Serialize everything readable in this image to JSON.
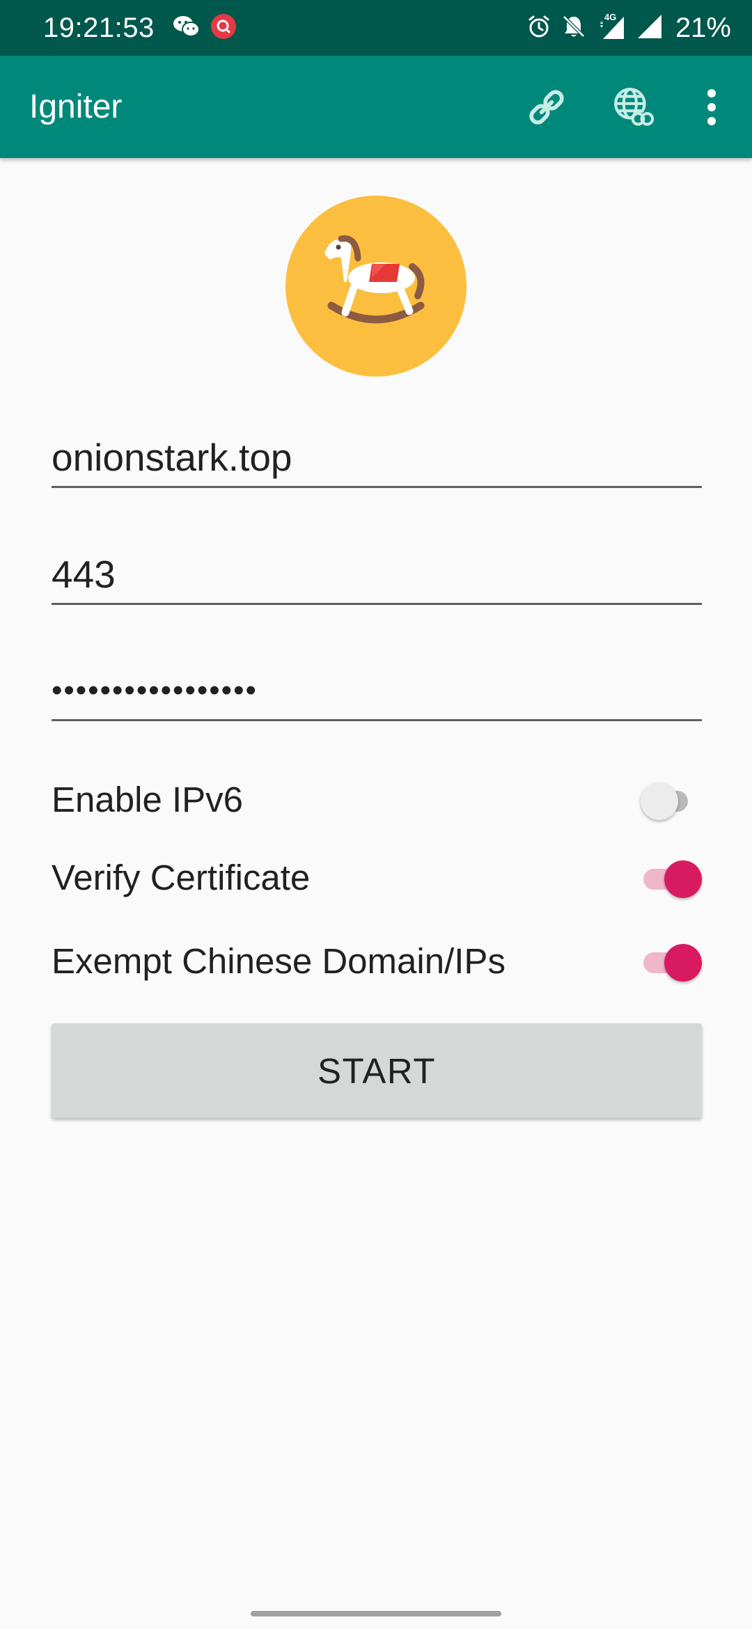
{
  "status_bar": {
    "time": "19:21:53",
    "network_label": "4G",
    "battery": "21%",
    "left_icons": [
      "wechat-icon",
      "notification-app-icon"
    ],
    "right_icons": [
      "alarm-icon",
      "bell-off-icon",
      "4g-signal-icon",
      "signal-icon"
    ],
    "background_color": "#00574b"
  },
  "app_bar": {
    "title": "Igniter",
    "actions": [
      "link-icon",
      "globe-link-icon",
      "more-options-icon"
    ],
    "background_color": "#00897b"
  },
  "logo": {
    "icon": "rocking-horse-icon",
    "background_color": "#fbbe3f"
  },
  "form": {
    "server_address": "onionstark.top",
    "server_port": "443",
    "password_mask": "•••••••••••••••••"
  },
  "options": [
    {
      "label": "Enable IPv6",
      "enabled": false
    },
    {
      "label": "Verify Certificate",
      "enabled": true
    },
    {
      "label": "Exempt Chinese Domain/IPs",
      "enabled": true
    }
  ],
  "start_button": {
    "label": "START"
  },
  "accent_color": "#d81b60"
}
